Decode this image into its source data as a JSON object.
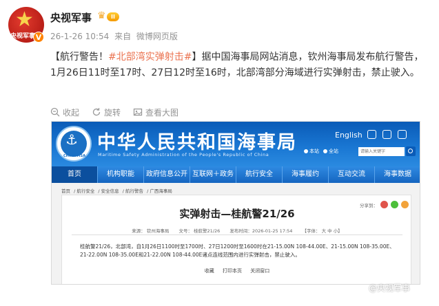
{
  "post": {
    "avatar_text": "央视军事",
    "verified_badge": "V",
    "username": "央视军事",
    "vip_level": "II",
    "time": "26-1-26 10:54",
    "source_prefix": "来自",
    "source": "微博网页版",
    "text_open": "【航行警告！",
    "hashtag": "#北部湾实弹射击#",
    "text_rest": "】据中国海事局网站消息，钦州海事局发布航行警告，1月26日11时至17时、27日12时至16时，北部湾部分海域进行实弹射击，禁止驶入。",
    "actions": {
      "collapse": "收起",
      "rotate": "旋转",
      "view_large": "查看大图"
    },
    "watermark": "@央视军事"
  },
  "screenshot": {
    "site_title": "中华人民共和国海事局",
    "site_subtitle": "Maritime Safety Administration of the People's Republic of China",
    "emblem_caption": "CHINA MSA",
    "lang": "English",
    "radio_site": "本站",
    "radio_all": "全站",
    "search_placeholder": "请输入关键字",
    "nav": [
      "首页",
      "机构职能",
      "政府信息公开",
      "互联网＋政务",
      "航行安全",
      "海事履约",
      "互动交流",
      "海事数据"
    ],
    "breadcrumbs": [
      "首页",
      "/ 航行安全",
      "/ 安全信息",
      "/ 航行警告",
      "/ 广西海事局"
    ],
    "share_label": "分享到：",
    "article": {
      "title": "实弹射击—桂航警21/26",
      "source": "来源：  钦州海事局",
      "doc_no": "文号：  桂航警21/26",
      "date": "发布时间：2026-01-25 17:54",
      "font": "【字体：  大  中  小】",
      "body": "桂航警21/26，北部湾，自1月26日1100时至1700时、27日1200时至1600时在21-15.00N 108-44.00E、21-15.00N 108-35.00E、21-22.00N 108-35.00E和21-22.00N 108-44.00E诸点连线范围内进行实弹射击，禁止驶入。",
      "actions": [
        "收藏",
        "打印本页",
        "关闭窗口"
      ]
    }
  },
  "colors": {
    "hashtag": "#eb7350",
    "banner_blue": "#1976d2",
    "nav_blue": "#1565c0"
  }
}
